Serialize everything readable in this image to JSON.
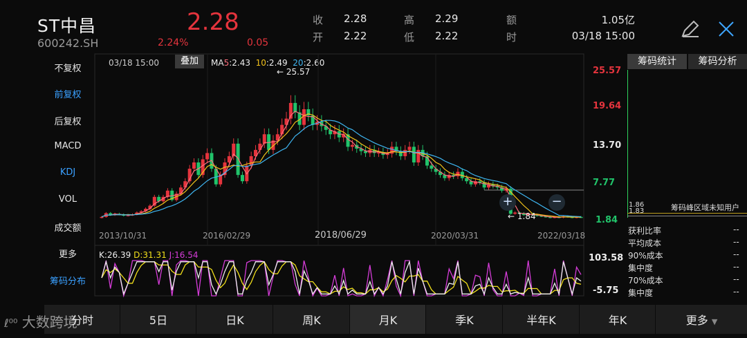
{
  "header": {
    "name": "ST中昌",
    "code": "600242.SH",
    "price": "2.28",
    "change_pct": "2.24%",
    "change": "0.05",
    "quote": [
      {
        "label": "收",
        "value": "2.28"
      },
      {
        "label": "开",
        "value": "2.22"
      },
      {
        "label": "高",
        "value": "2.29"
      },
      {
        "label": "低",
        "value": "2.22"
      },
      {
        "label": "额",
        "value": "1.05亿"
      },
      {
        "label": "时",
        "value": "03/18 15:00"
      }
    ]
  },
  "left_menu": [
    "不复权",
    "前复权",
    "后复权",
    "MACD",
    "KDJ",
    "VOL",
    "成交额",
    "更多",
    "筹码分布"
  ],
  "chart": {
    "time": "03/18 15:00",
    "overlay_button": "叠加",
    "ma": [
      {
        "label": "MA",
        "period": "5",
        "value": ":2.43"
      },
      {
        "label": "",
        "period": "10",
        "value": ":2.49"
      },
      {
        "label": "",
        "period": "20",
        "value": ":2.60"
      }
    ],
    "y_ticks": [
      "25.57",
      "19.64",
      "13.70",
      "7.77",
      "1.84"
    ],
    "x_ticks": [
      "2013/10/31",
      "2016/02/29",
      "2018/06/29",
      "2020/03/31",
      "2022/03/18"
    ],
    "high_marker": "25.57",
    "low_marker": "1.84",
    "kdj": {
      "k": "K:26.39",
      "d": "D:31.31",
      "j": "J:16.54"
    },
    "sub_y_ticks": [
      "103.58",
      "-5.75"
    ]
  },
  "side_panel": {
    "tabs": [
      "筹码统计",
      "筹码分析"
    ],
    "top_values": [
      "1.86",
      "1.83"
    ],
    "top_text": "筹码峰区域未知用户",
    "rows": [
      {
        "label": "获利比率",
        "value": "--"
      },
      {
        "label": "平均成本",
        "value": "--"
      },
      {
        "label": "90%成本",
        "value": "--"
      },
      {
        "label": "集中度",
        "value": "--"
      },
      {
        "label": "70%成本",
        "value": "--"
      },
      {
        "label": "集中度",
        "value": "--"
      }
    ]
  },
  "bottom_tabs": [
    "分时",
    "5日",
    "日K",
    "周K",
    "月K",
    "季K",
    "半年K",
    "年K",
    "更多"
  ],
  "selected_tab": "月K",
  "watermark": "大数跨境",
  "chart_data": {
    "type": "candlestick",
    "period": "monthly",
    "x_ticks": [
      "2013/10/31",
      "2016/02/29",
      "2018/06/29",
      "2020/03/31",
      "2022/03/18"
    ],
    "ylim": [
      1.84,
      25.57
    ],
    "close": [
      2.3,
      2.9,
      2.6,
      2.8,
      2.7,
      2.5,
      2.6,
      2.7,
      3.0,
      3.2,
      3.6,
      4.1,
      5.5,
      4.8,
      5.5,
      6.5,
      5.0,
      6.0,
      7.0,
      8.0,
      10.0,
      11.0,
      9.0,
      11.5,
      12.5,
      10.0,
      7.5,
      9.0,
      11.0,
      12.0,
      14.0,
      9.0,
      8.0,
      10.5,
      12.0,
      13.0,
      14.0,
      15.5,
      13.0,
      14.5,
      15.5,
      17.0,
      18.0,
      20.5,
      19.0,
      17.0,
      19.5,
      18.5,
      17.0,
      17.5,
      16.8,
      16.2,
      15.5,
      16.0,
      15.0,
      15.5,
      13.5,
      13.8,
      13.2,
      12.8,
      12.5,
      13.0,
      12.5,
      12.6,
      12.2,
      12.4,
      13.5,
      12.8,
      12.0,
      13.0,
      13.5,
      11.0,
      13.0,
      12.0,
      10.5,
      10.0,
      9.5,
      9.0,
      8.5,
      9.0,
      8.8,
      9.5,
      8.5,
      8.0,
      7.5,
      8.0,
      7.8,
      7.0,
      7.5,
      7.2,
      7.0,
      6.5,
      6.8,
      2.8,
      3.0,
      2.9,
      2.6,
      2.8,
      2.6,
      2.5,
      2.4,
      2.3,
      2.2,
      2.3,
      2.2,
      2.4,
      2.3,
      2.2,
      2.3,
      2.28
    ],
    "ma": {
      "MA5": "2.43",
      "MA10": "2.49",
      "MA20": "2.60"
    }
  }
}
